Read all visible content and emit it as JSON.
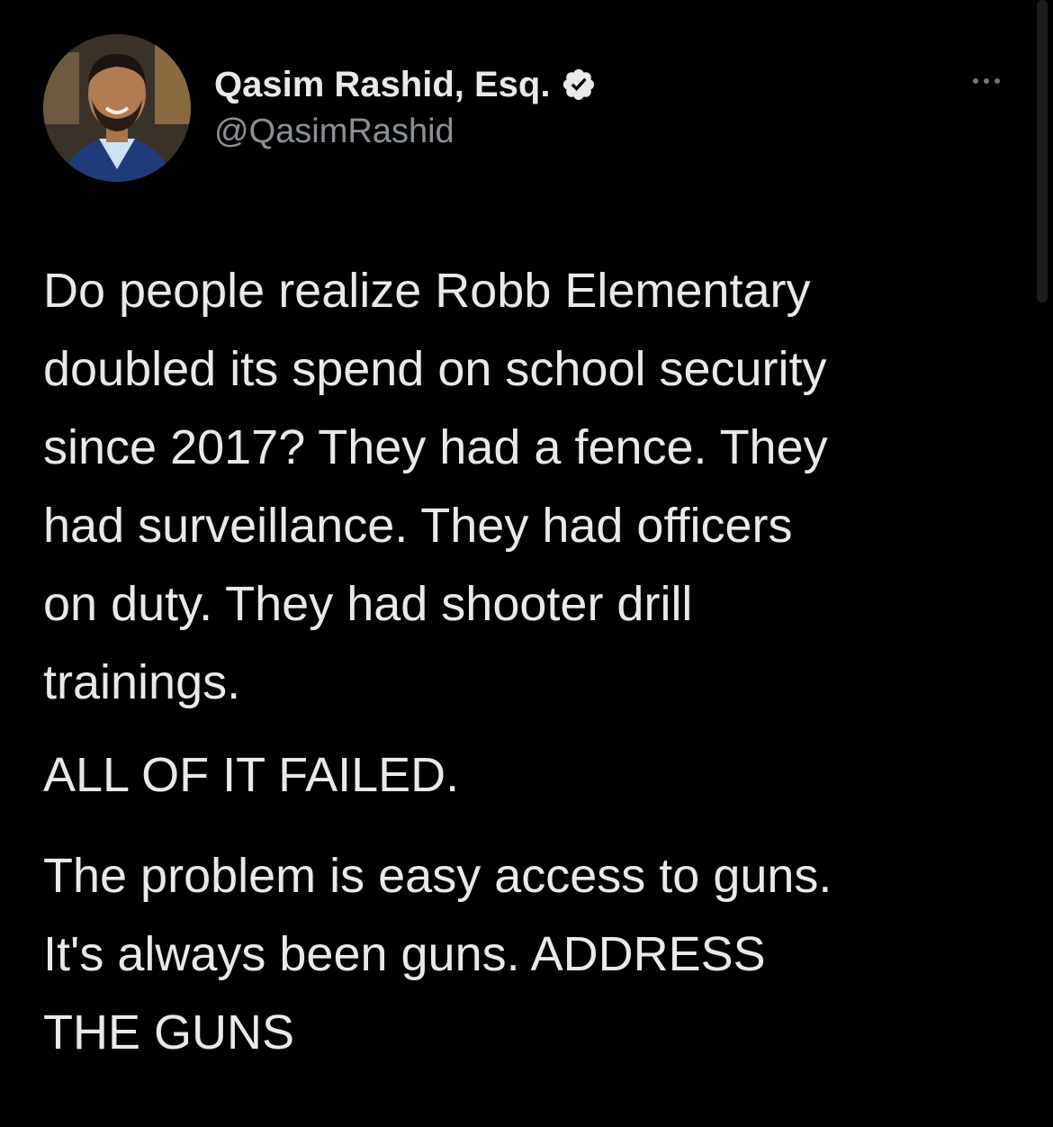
{
  "author": {
    "display_name": "Qasim Rashid, Esq.",
    "handle": "@QasimRashid",
    "verified": true,
    "avatar_icon": "profile-photo"
  },
  "actions": {
    "more_icon": "more-horizontal-icon"
  },
  "tweet": {
    "paragraph_1_lines": [
      "Do people realize Robb Elementary",
      "doubled its spend on school security",
      "since 2017? They had a fence. They",
      "had surveillance. They had officers",
      "on duty. They had shooter drill",
      "trainings."
    ],
    "paragraph_2": "ALL OF IT FAILED.",
    "paragraph_3_lines": [
      "The problem is easy access to guns.",
      "It's always been guns. ADDRESS",
      "THE GUNS"
    ]
  },
  "colors": {
    "background": "#000000",
    "text_primary": "#e7e9ea",
    "text_secondary": "#8b9096",
    "verified_badge": "#e7e9ea"
  }
}
